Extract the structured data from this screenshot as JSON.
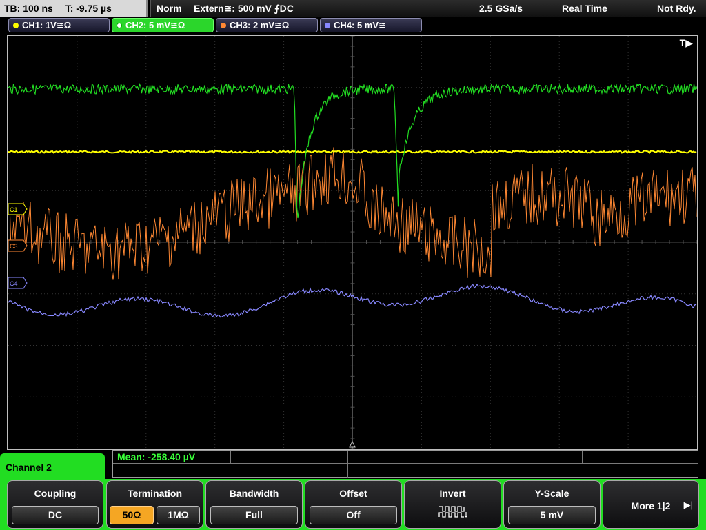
{
  "topbar": {
    "timebase": "TB: 100 ns",
    "trigger_time": "T: -9.75 µs",
    "mode": "Norm",
    "trigger_source": "Extern≅: 500 mV ⨍DC",
    "sample_rate": "2.5 GSa/s",
    "acq_mode": "Real Time",
    "status": "Not Rdy."
  },
  "channels": [
    {
      "label": "CH1: 1V≅Ω",
      "color": "#ffff00",
      "active": false
    },
    {
      "label": "CH2: 5 mV≅Ω",
      "color": "#22dd22",
      "active": true
    },
    {
      "label": "CH3: 2 mV≅Ω",
      "color": "#ff8833",
      "active": false
    },
    {
      "label": "CH4: 5 mV≅",
      "color": "#8888ff",
      "active": false
    }
  ],
  "markers": {
    "trigger": "T▶",
    "c1": "C1",
    "c3": "C3",
    "c4": "C4"
  },
  "panel": {
    "title": "Channel 2",
    "measurement": "Mean: -258.40 µV"
  },
  "menu": {
    "coupling": {
      "label": "Coupling",
      "value": "DC"
    },
    "termination": {
      "label": "Termination",
      "options": [
        "50Ω",
        "1MΩ"
      ],
      "selected": "50Ω"
    },
    "bandwidth": {
      "label": "Bandwidth",
      "value": "Full"
    },
    "offset": {
      "label": "Offset",
      "value": "Off"
    },
    "invert": {
      "label": "Invert",
      "icon": "invert-wave-icon"
    },
    "yscale": {
      "label": "Y-Scale",
      "value": "5 mV"
    },
    "more": {
      "label": "More 1|2"
    }
  },
  "colors": {
    "ch1": "#ffff00",
    "ch2": "#22dd22",
    "ch3": "#ff8833",
    "ch4": "#8888ff",
    "menu_bg": "#22dd22",
    "selected_option": "#f5a623"
  }
}
